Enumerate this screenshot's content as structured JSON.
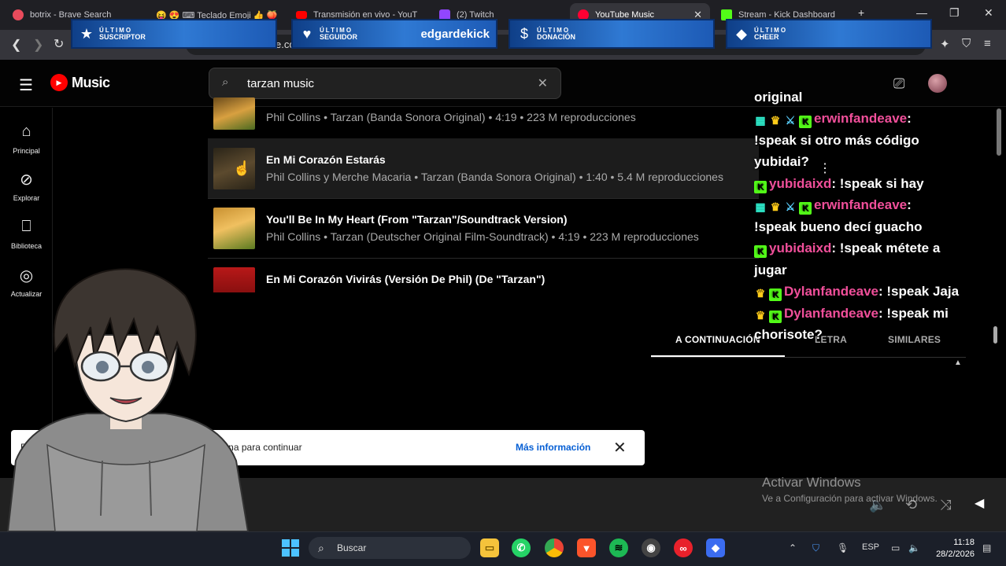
{
  "browser": {
    "tabs": [
      {
        "label": "botrix - Brave Search",
        "active": false
      },
      {
        "label": "😝 😍 ⌨ Teclado Emoji 👍 🍑",
        "active": false
      },
      {
        "label": "Transmisión en vivo - YouT",
        "active": false
      },
      {
        "label": "(2) Twitch",
        "active": false
      },
      {
        "label": "YouTube Music",
        "active": true
      },
      {
        "label": "Stream - Kick Dashboard",
        "active": false
      }
    ],
    "new_tab": "+",
    "address_fragment": "e.co"
  },
  "alerts": [
    {
      "top": "ÚLTIMO",
      "bottom": "SUSCRIPTOR",
      "icon": "star-icon",
      "name": ""
    },
    {
      "top": "ÚLTIMO",
      "bottom": "SEGUIDOR",
      "icon": "heart-icon",
      "name": "edgardekick"
    },
    {
      "top": "ÚLTIMO",
      "bottom": "DONACIÓN",
      "icon": "dollar-icon",
      "name": ""
    },
    {
      "top": "ÚLTIMO",
      "bottom": "CHEER",
      "icon": "diamond-icon",
      "name": ""
    }
  ],
  "ytm": {
    "logo": "Music",
    "search_value": "tarzan music",
    "sidebar": [
      {
        "label": "Principal",
        "icon": "home-icon"
      },
      {
        "label": "Explorar",
        "icon": "compass-icon"
      },
      {
        "label": "Biblioteca",
        "icon": "bookmark-icon"
      },
      {
        "label": "Actualizar",
        "icon": "upgrade-icon"
      }
    ],
    "songs": [
      {
        "title": "",
        "meta": "Phil Collins • Tarzan (Banda Sonora Original) • 4:19 • 223 M reproducciones"
      },
      {
        "title": "En Mi Corazón Estarás",
        "meta": "Phil Collins y Merche Macaria • Tarzan (Banda Sonora Original) • 1:40 • 5.4 M reproducciones"
      },
      {
        "title": "You'll Be In My Heart (From \"Tarzan\"/Soundtrack Version)",
        "meta": "Phil Collins • Tarzan (Deutscher Original Film-Soundtrack) • 4:19 • 223 M reproducciones"
      },
      {
        "title": "En Mi Corazón Vivirás (Versión De Phil) (De \"Tarzan\")",
        "meta": ""
      }
    ],
    "player_tabs": [
      "A CONTINUACIÓN",
      "LETRA",
      "SIMILARES"
    ],
    "toast": {
      "text": "El m                                      do en el contenido creado para niños; presiona para continuar",
      "link": "Más información"
    }
  },
  "chat": [
    {
      "user": "",
      "text": "original"
    },
    {
      "user": "erwinfandeave",
      "text": ":"
    },
    {
      "user": "",
      "text": "!speak si otro más código"
    },
    {
      "user": "",
      "text": "yubidai?"
    },
    {
      "user": "yubidaixd",
      "text": ": !speak si hay"
    },
    {
      "user": "erwinfandeave",
      "text": ":"
    },
    {
      "user": "",
      "text": "!speak bueno decí guacho"
    },
    {
      "user": "yubidaixd",
      "text": ": !speak métete a"
    },
    {
      "user": "",
      "text": "jugar"
    },
    {
      "user": "Dylanfandeave",
      "text": ": !speak Jaja"
    },
    {
      "user": "Dylanfandeave",
      "text": ": !speak mi"
    },
    {
      "user": "",
      "text": "chorisote?"
    }
  ],
  "watermark": {
    "title": "Activar Windows",
    "subtitle": "Ve a Configuración para activar Windows."
  },
  "taskbar": {
    "search_label": "Buscar",
    "language": "ESP",
    "time": "11:18",
    "date": "28/2/2026"
  }
}
